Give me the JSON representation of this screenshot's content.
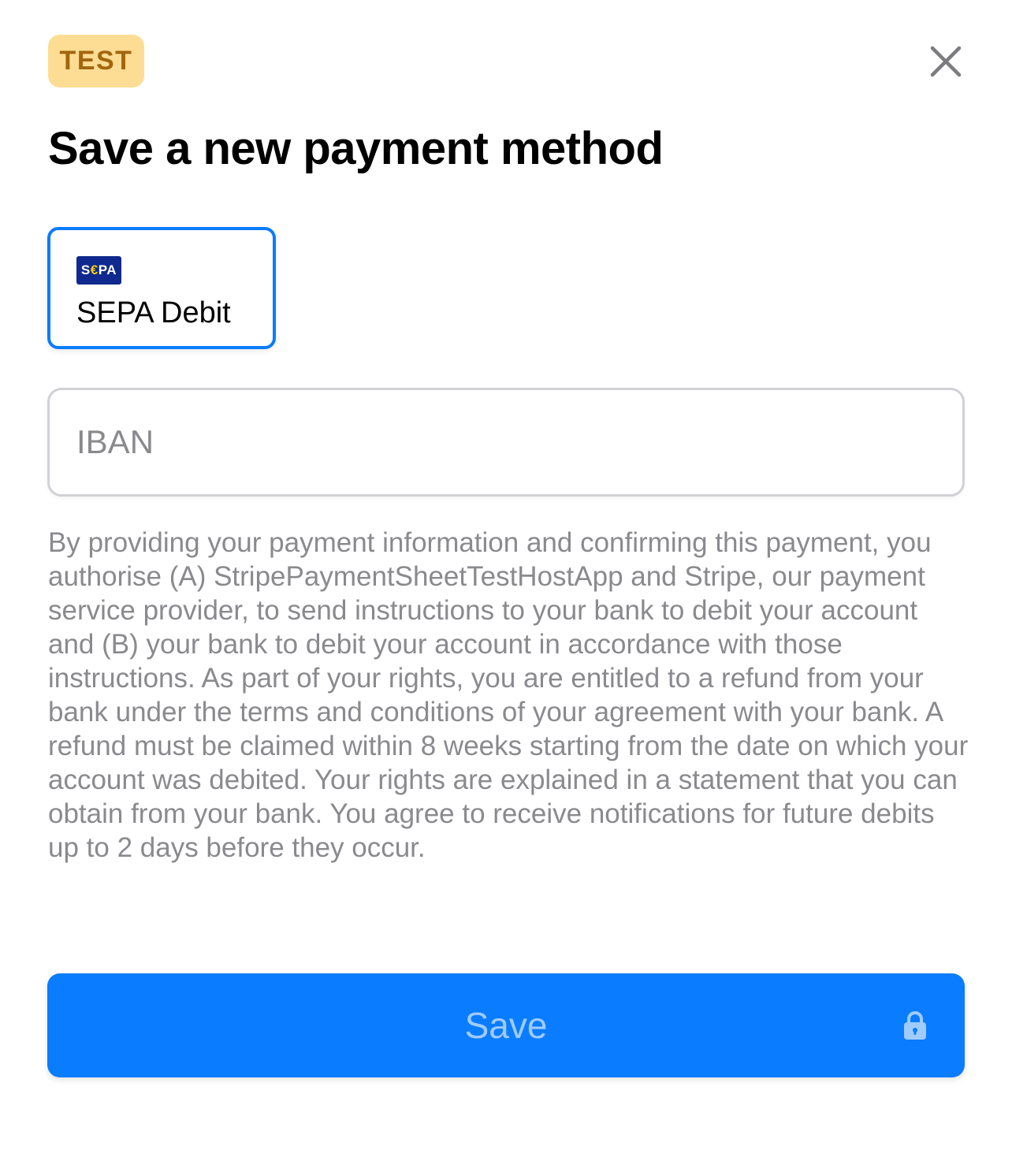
{
  "badge": {
    "label": "TEST"
  },
  "header": {
    "title": "Save a new payment method",
    "close_icon": "close-icon"
  },
  "payment_methods": [
    {
      "logo_text_left": "S",
      "logo_text_euro": "€",
      "logo_text_right": "PA",
      "label": "SEPA Debit",
      "selected": true
    }
  ],
  "iban": {
    "placeholder": "IBAN",
    "value": ""
  },
  "mandate": {
    "text": "By providing your payment information and confirming this payment, you authorise (A) StripePaymentSheetTestHostApp and Stripe, our payment service provider, to send instructions to your bank to debit your account and (B) your bank to debit your account in accordance with those instructions. As part of your rights, you are entitled to a refund from your bank under the terms and conditions of your agreement with your bank. A refund must be claimed within 8 weeks starting from the date on which your account was debited. Your rights are explained in a statement that you can obtain from your bank. You agree to receive notifications for future debits up to 2 days before they occur."
  },
  "save_button": {
    "label": "Save",
    "icon": "lock-icon",
    "enabled": false
  },
  "colors": {
    "accent": "#0a7cff",
    "badge_bg": "#fcdd93",
    "badge_text": "#a3650e",
    "secondary_text": "#8a8a8e",
    "disabled_label": "#9fcbff"
  }
}
